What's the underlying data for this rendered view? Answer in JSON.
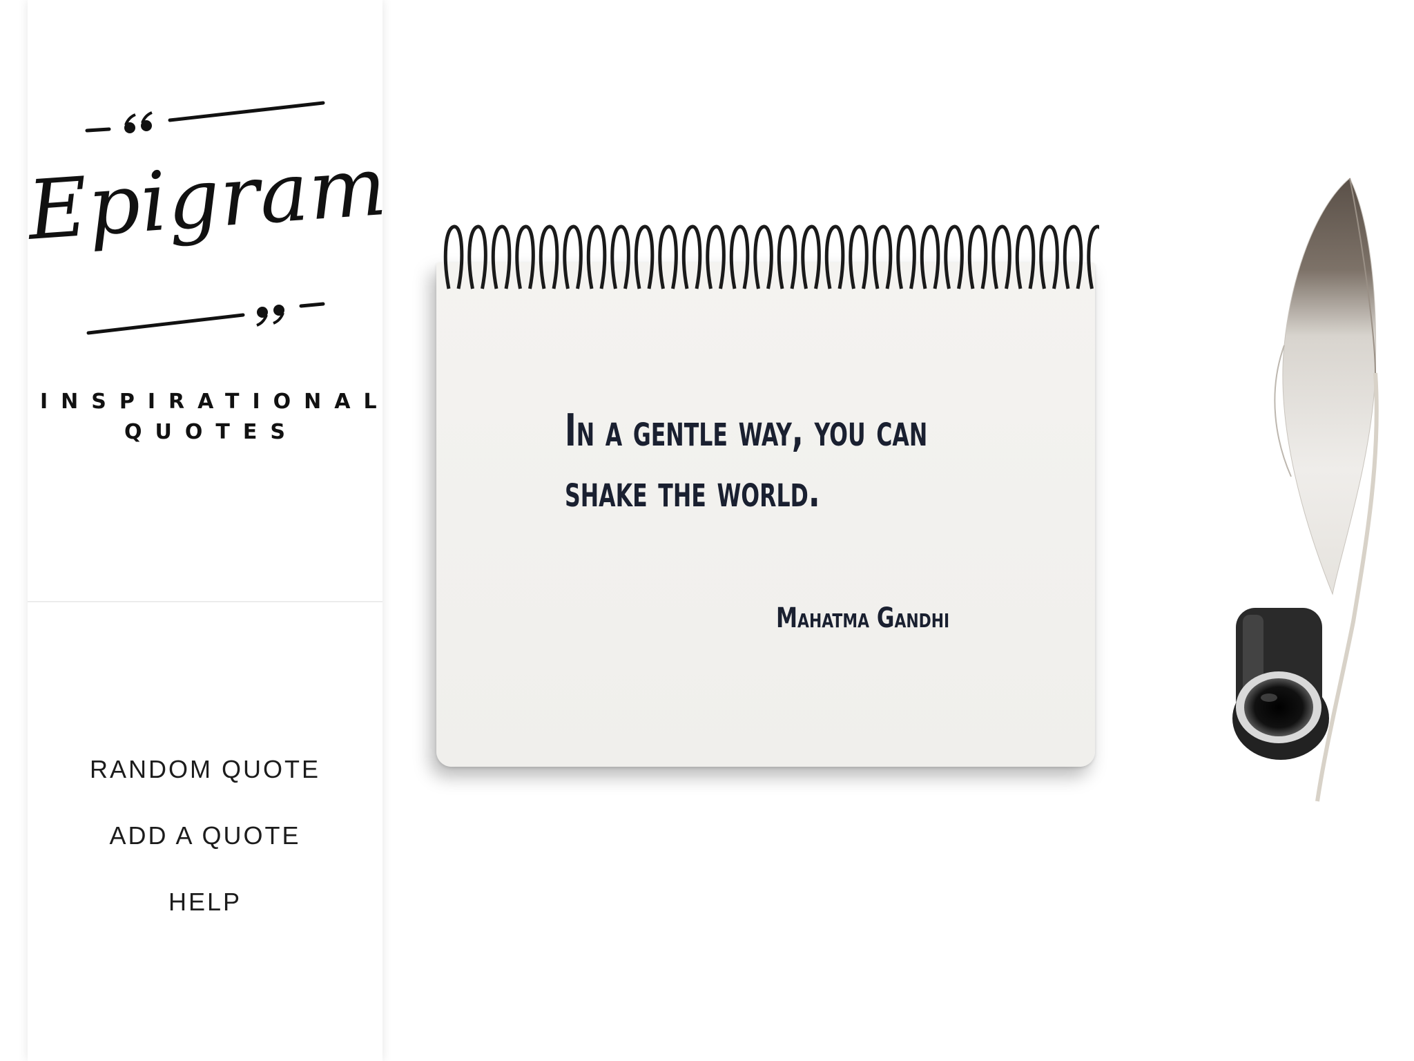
{
  "brand": {
    "logo_word": "Epigram",
    "tagline_line1": "INSPIRATIONAL",
    "tagline_line2": "QUOTES"
  },
  "nav": {
    "items": [
      {
        "label": "RANDOM QUOTE"
      },
      {
        "label": "ADD A QUOTE"
      },
      {
        "label": "HELP"
      }
    ]
  },
  "quote": {
    "text": "In a gentle way, you can shake the world.",
    "author": "Mahatma Gandhi"
  },
  "colors": {
    "text_dark": "#1a2030",
    "paper": "#f2f1ee",
    "sidebar_bg": "#ffffff"
  },
  "icons": {
    "open_quote": "opening-quote-mark-icon",
    "close_quote": "closing-quote-mark-icon",
    "quill": "quill-feather-icon",
    "inkwell": "inkwell-icon"
  }
}
